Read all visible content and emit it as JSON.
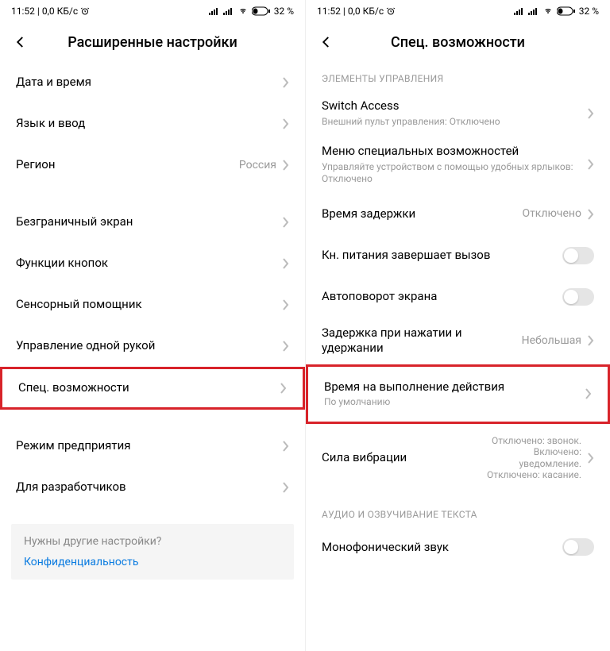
{
  "status": {
    "time": "11:52",
    "net_speed": "0,0 КБ/с",
    "battery_percent": "32 %"
  },
  "left": {
    "title": "Расширенные настройки",
    "items": [
      {
        "title": "Дата и время"
      },
      {
        "title": "Язык и ввод"
      },
      {
        "title": "Регион",
        "value": "Россия"
      }
    ],
    "items2": [
      {
        "title": "Безграничный экран"
      },
      {
        "title": "Функции кнопок"
      },
      {
        "title": "Сенсорный помощник"
      },
      {
        "title": "Управление одной рукой"
      },
      {
        "title": "Спец. возможности",
        "highlight": true
      }
    ],
    "items3": [
      {
        "title": "Режим предприятия"
      },
      {
        "title": "Для разработчиков"
      }
    ],
    "footer": {
      "prompt": "Нужны другие настройки?",
      "link": "Конфиденциальность"
    }
  },
  "right": {
    "title": "Спец. возможности",
    "section1": "ЭЛЕМЕНТЫ УПРАВЛЕНИЯ",
    "items": [
      {
        "title": "Switch Access",
        "sub": "Внешний пульт управления: Отключено"
      },
      {
        "title": "Меню специальных возможностей",
        "sub": "Управляйте устройством с помощью удобных ярлыков: Отключено"
      },
      {
        "title": "Время задержки",
        "value": "Отключено"
      },
      {
        "title": "Кн. питания завершает вызов",
        "toggle": true
      },
      {
        "title": "Автоповорот экрана",
        "toggle": true
      },
      {
        "title": "Задержка при нажатии и удержании",
        "value": "Небольшая"
      },
      {
        "title": "Время на выполнение действия",
        "sub": "По умолчанию",
        "highlight": true
      },
      {
        "title": "Сила вибрации",
        "value": "Отключено: звонок. Включено: уведомление. Отключено: касание."
      }
    ],
    "section2": "АУДИО И ОЗВУЧИВАНИЕ ТЕКСТА",
    "items2": [
      {
        "title": "Монофонический звук",
        "toggle": true
      }
    ]
  }
}
